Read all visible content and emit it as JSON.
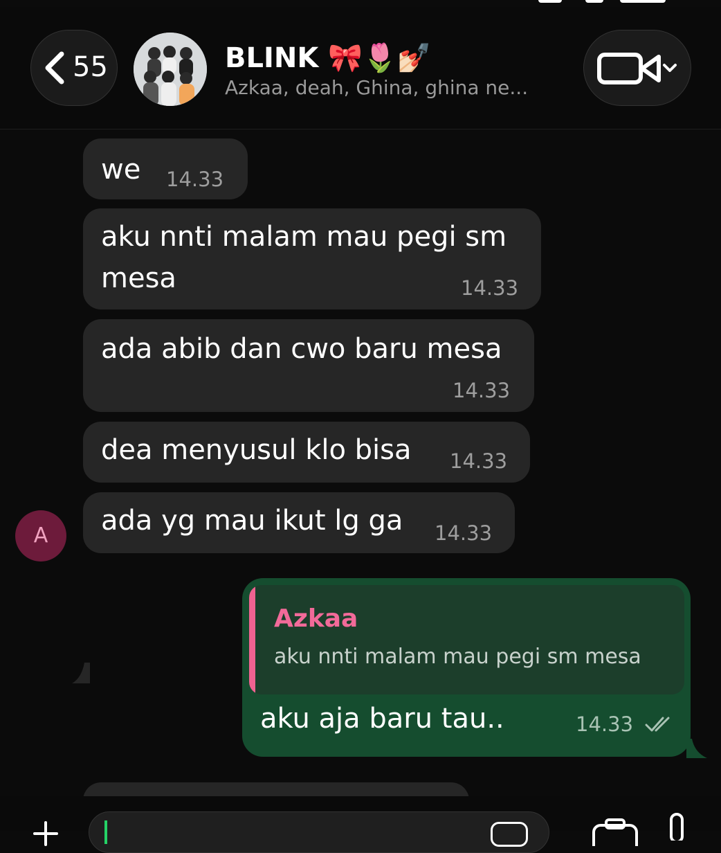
{
  "header": {
    "back_count": "55",
    "title": "BLINK 🎀🌷💅🏻",
    "subtitle": "Azkaa, deah, Ghina, ghina ne..."
  },
  "messages": [
    {
      "text": "we",
      "time": "14.33"
    },
    {
      "text_lines": [
        "aku nnti malam mau pegi sm",
        "mesa"
      ],
      "time": "14.33"
    },
    {
      "text": "ada abib dan cwo baru mesa",
      "time": "14.33"
    },
    {
      "text": "dea menyusul klo bisa",
      "time": "14.33"
    },
    {
      "text": "ada yg mau ikut lg ga",
      "time": "14.33",
      "sender_initial": "A"
    }
  ],
  "outgoing": {
    "quote_author": "Azkaa",
    "quote_text": "aku nnti malam mau pegi sm mesa",
    "text": "aku aja baru tau..",
    "time": "14.33",
    "status_icon": "double-check-icon"
  },
  "colors": {
    "background": "#0b0b0b",
    "incoming_bubble": "#262626",
    "outgoing_bubble": "#154d2f",
    "quote_accent": "#f06291",
    "sender_avatar": "#6d1b3b"
  }
}
